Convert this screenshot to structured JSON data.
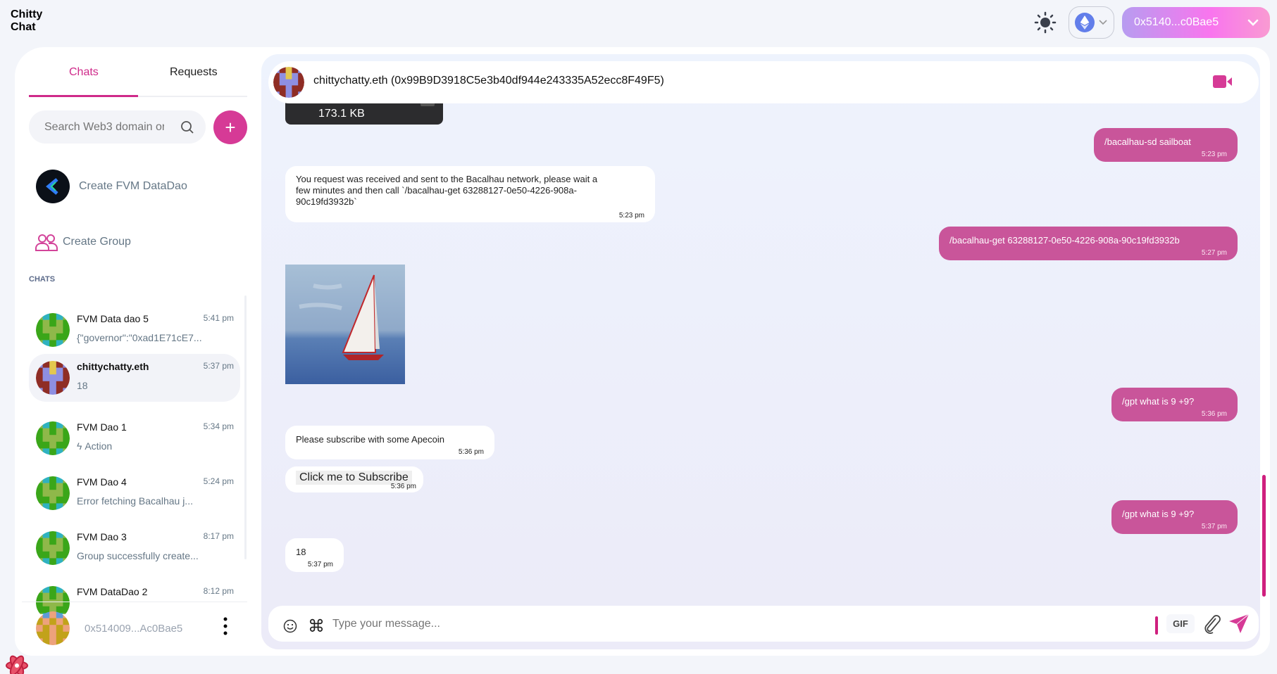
{
  "app": {
    "logo_line1": "Chitty",
    "logo_line2": "Chat"
  },
  "topbar": {
    "theme_icon": "sun-icon",
    "network_icon": "ethereum-icon",
    "wallet_address": "0x5140...c0Bae5"
  },
  "colors": {
    "accent": "#d63a96",
    "sent_bubble": "#c9559a",
    "tab_active": "#cf2a8a"
  },
  "sidebar": {
    "tabs": [
      {
        "label": "Chats",
        "active": true
      },
      {
        "label": "Requests",
        "active": false
      }
    ],
    "search_placeholder": "Search Web3 domain or",
    "create_datadao": "Create FVM DataDao",
    "create_group": "Create Group",
    "section_label": "CHATS",
    "chats": [
      {
        "name": "FVM Data dao 5",
        "time": "5:41 pm",
        "preview": "{\"governor\":\"0xad1E71cE7...",
        "palette": "green"
      },
      {
        "name": "chittychatty.eth",
        "time": "5:37 pm",
        "preview": "18",
        "palette": "purple",
        "selected": true
      },
      {
        "name": "FVM Dao 1",
        "time": "5:34 pm",
        "preview": "Action",
        "preview_icon": "lightning-icon",
        "palette": "green"
      },
      {
        "name": "FVM Dao 4",
        "time": "5:24 pm",
        "preview": "Error fetching Bacalhau j...",
        "palette": "green"
      },
      {
        "name": "FVM Dao 3",
        "time": "8:17 pm",
        "preview": "Group successfully create...",
        "palette": "green"
      },
      {
        "name": "FVM DataDao 2",
        "time": "8:12 pm",
        "preview": "",
        "palette": "green"
      }
    ],
    "profile_address": "0x514009...Ac0Bae5"
  },
  "conversation": {
    "title": "chittychatty.eth (0x99B9D3918C5e3b40df944e243335A52ecc8F49F5)",
    "file_size": "173.1 KB",
    "messages": [
      {
        "dir": "sent",
        "text": "/bacalhau-sd sailboat",
        "time": "5:23 pm"
      },
      {
        "dir": "recv",
        "text": "You request was received and sent to the Bacalhau network, please wait a few minutes and then call `/bacalhau-get 63288127-0e50-4226-908a-90c19fd3932b`",
        "time": "5:23 pm"
      },
      {
        "dir": "sent",
        "text": "/bacalhau-get 63288127-0e50-4226-908a-90c19fd3932b",
        "time": "5:27 pm"
      },
      {
        "dir": "sent",
        "text": "/gpt what is 9 +9?",
        "time": "5:36 pm"
      },
      {
        "dir": "recv",
        "text": "Please subscribe with some Apecoin",
        "time": "5:36 pm"
      },
      {
        "dir": "recv",
        "button": "Click me to Subscribe",
        "time": "5:36 pm"
      },
      {
        "dir": "sent",
        "text": "/gpt what is 9 +9?",
        "time": "5:37 pm"
      },
      {
        "dir": "recv",
        "text": "18",
        "time": "5:37 pm"
      }
    ],
    "input_placeholder": "Type your message...",
    "gif_label": "GIF"
  }
}
